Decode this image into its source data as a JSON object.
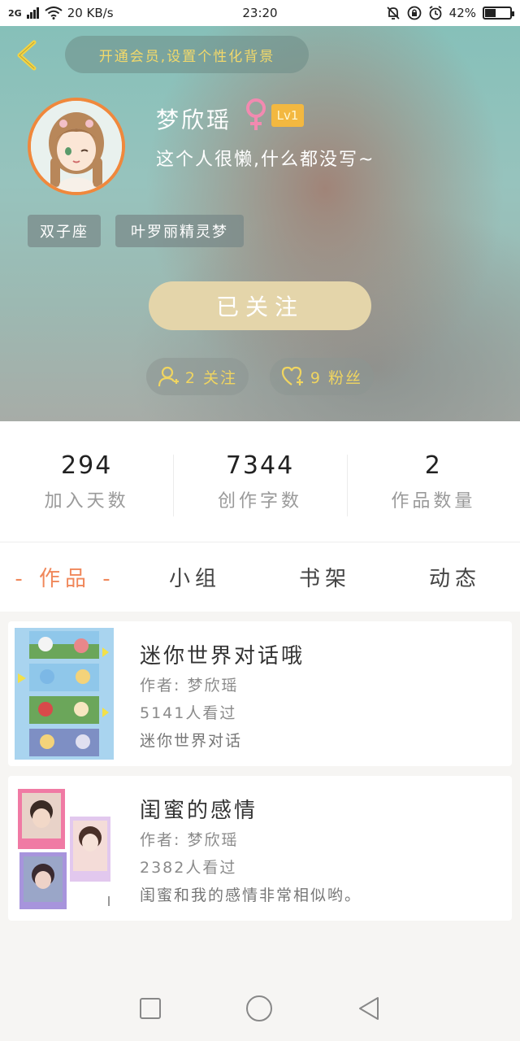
{
  "status_bar": {
    "network": "2G",
    "speed": "20 KB/s",
    "time": "23:20",
    "battery": "42%",
    "battery_level": 0.42
  },
  "header": {
    "vip_banner": "开通会员,设置个性化背景",
    "username": "梦欣瑶",
    "level": "Lv1",
    "signature": "这个人很懒,什么都没写~",
    "tags": [
      "双子座",
      "叶罗丽精灵梦"
    ],
    "follow_button": "已关注",
    "following_label": "2 关注",
    "fans_label": "9 粉丝"
  },
  "stats": [
    {
      "value": "294",
      "label": "加入天数"
    },
    {
      "value": "7344",
      "label": "创作字数"
    },
    {
      "value": "2",
      "label": "作品数量"
    }
  ],
  "tabs": [
    {
      "label": "- 作品 -",
      "active": true
    },
    {
      "label": "小组",
      "active": false
    },
    {
      "label": "书架",
      "active": false
    },
    {
      "label": "动态",
      "active": false
    }
  ],
  "works": [
    {
      "title": "迷你世界对话哦",
      "author": "作者: 梦欣瑶",
      "views": "5141人看过",
      "desc": "迷你世界对话"
    },
    {
      "title": "闺蜜的感情",
      "author": "作者: 梦欣瑶",
      "views": "2382人看过",
      "desc": "闺蜜和我的感情非常相似哟。"
    }
  ],
  "colors": {
    "accent": "#f0875a",
    "gold": "#f2d96b",
    "follow_button": "#e4d5aa",
    "avatar_border": "#f0883c"
  },
  "icons": [
    "back-chevron-icon",
    "female-icon",
    "add-user-icon",
    "heart-plus-icon",
    "square-nav-icon",
    "circle-nav-icon",
    "triangle-back-icon"
  ]
}
